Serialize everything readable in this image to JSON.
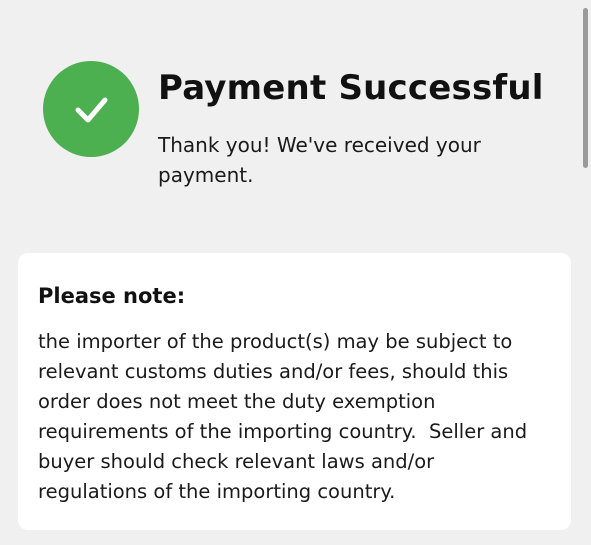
{
  "status": {
    "icon": "checkmark-icon",
    "icon_color": "#4caf50",
    "title": "Payment Successful",
    "message": "Thank you! We've received your\npayment."
  },
  "note": {
    "heading": "Please note:",
    "body": "the importer of the product(s) may be subject to\nrelevant customs duties and/or fees, should this\norder does not meet the duty exemption\nrequirements of the importing country.  Seller and\nbuyer should check relevant laws and/or\nregulations of the importing country."
  }
}
